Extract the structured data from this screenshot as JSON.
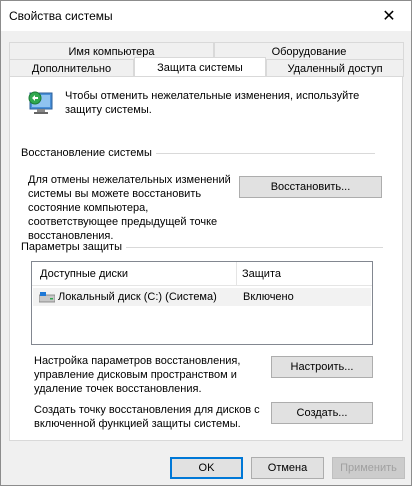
{
  "window": {
    "title": "Свойства системы"
  },
  "tabs": {
    "row1": [
      {
        "label": "Имя компьютера"
      },
      {
        "label": "Оборудование"
      }
    ],
    "row2": [
      {
        "label": "Дополнительно"
      },
      {
        "label": "Защита системы"
      },
      {
        "label": "Удаленный доступ"
      }
    ],
    "active": "Защита системы"
  },
  "intro": {
    "text": "Чтобы отменить нежелательные изменения, используйте защиту системы."
  },
  "restore": {
    "group_label": "Восстановление системы",
    "text": "Для отмены нежелательных изменений системы вы можете восстановить состояние компьютера, соответствующее предыдущей точке восстановления.",
    "button": "Восстановить..."
  },
  "protection": {
    "group_label": "Параметры защиты",
    "columns": [
      "Доступные диски",
      "Защита"
    ],
    "rows": [
      {
        "drive": "Локальный диск (C:) (Система)",
        "status": "Включено"
      }
    ],
    "configure_text": "Настройка параметров восстановления, управление дисковым пространством и удаление точек восстановления.",
    "configure_button": "Настроить...",
    "create_text": "Создать точку восстановления для дисков с включенной функцией защиты системы.",
    "create_button": "Создать..."
  },
  "footer": {
    "ok": "OK",
    "cancel": "Отмена",
    "apply": "Применить"
  }
}
